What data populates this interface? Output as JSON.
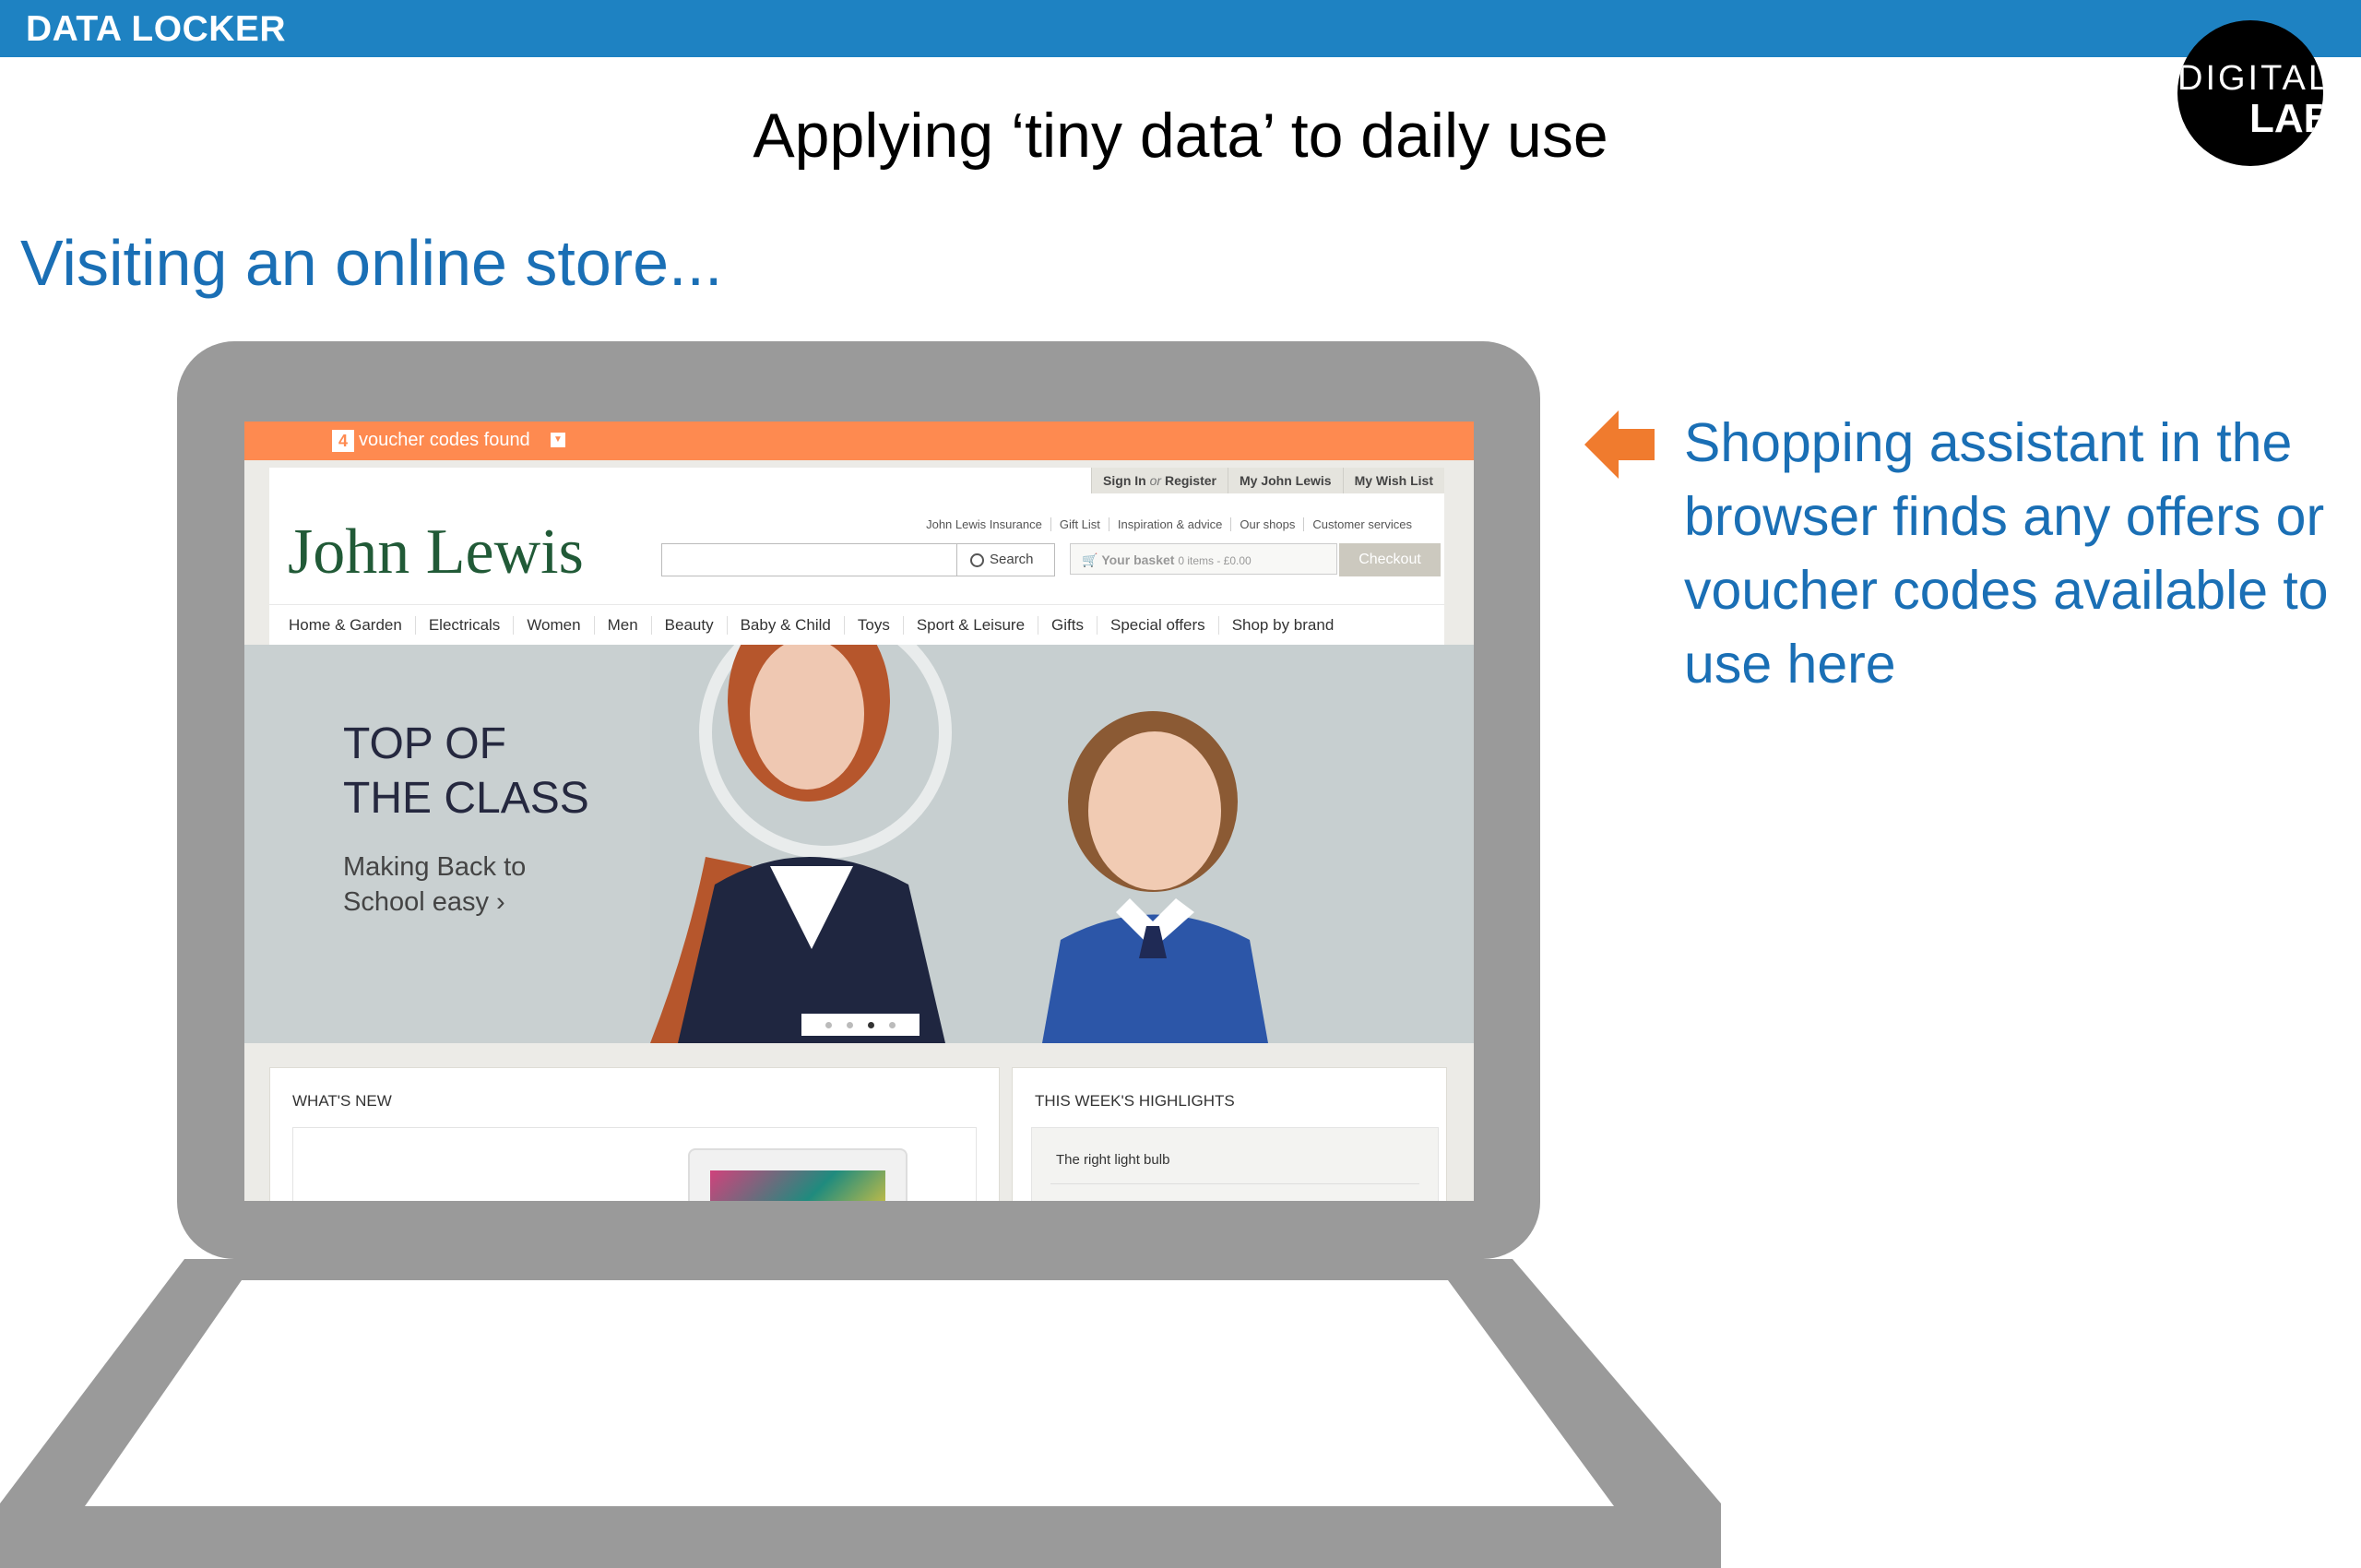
{
  "header": {
    "brand": "DATA LOCKER"
  },
  "logo": {
    "top": "DIGITAL",
    "bottom": "LAB"
  },
  "slide": {
    "title": "Applying ‘tiny data’ to daily use",
    "subtitle": "Visiting an online store..."
  },
  "voucher_bar": {
    "count": "4",
    "text": "voucher codes found"
  },
  "store": {
    "account_links": {
      "sign_in": "Sign In",
      "or": "or",
      "register": "Register",
      "my_account": "My John Lewis",
      "wish_list": "My Wish List"
    },
    "brand": "John Lewis",
    "utility_links": [
      "John Lewis Insurance",
      "Gift List",
      "Inspiration & advice",
      "Our shops",
      "Customer services"
    ],
    "search_label": "Search",
    "basket": {
      "label": "Your basket",
      "summary": "0 items - £0.00"
    },
    "checkout_label": "Checkout",
    "nav": [
      "Home & Garden",
      "Electricals",
      "Women",
      "Men",
      "Beauty",
      "Baby & Child",
      "Toys",
      "Sport & Leisure",
      "Gifts",
      "Special offers",
      "Shop by brand"
    ],
    "hero": {
      "line1": "TOP OF",
      "line2": "THE CLASS",
      "sub1": "Making Back to",
      "sub2": "School easy ›"
    },
    "carousel": {
      "active_index": 2,
      "count": 4
    },
    "whats_new_title": "WHAT'S NEW",
    "highlights_title": "THIS WEEK'S HIGHLIGHTS",
    "highlight_item": "The right light bulb"
  },
  "callout": {
    "text": "Shopping assistant in the browser finds any offers or voucher codes available to use here"
  },
  "colors": {
    "topbar": "#1e82c2",
    "accent_blue": "#1a6fb5",
    "voucher_orange": "#fe8a50",
    "arrow_orange": "#f07b2e",
    "laptop_gray": "#9a9a9a",
    "jl_green": "#215a37"
  }
}
